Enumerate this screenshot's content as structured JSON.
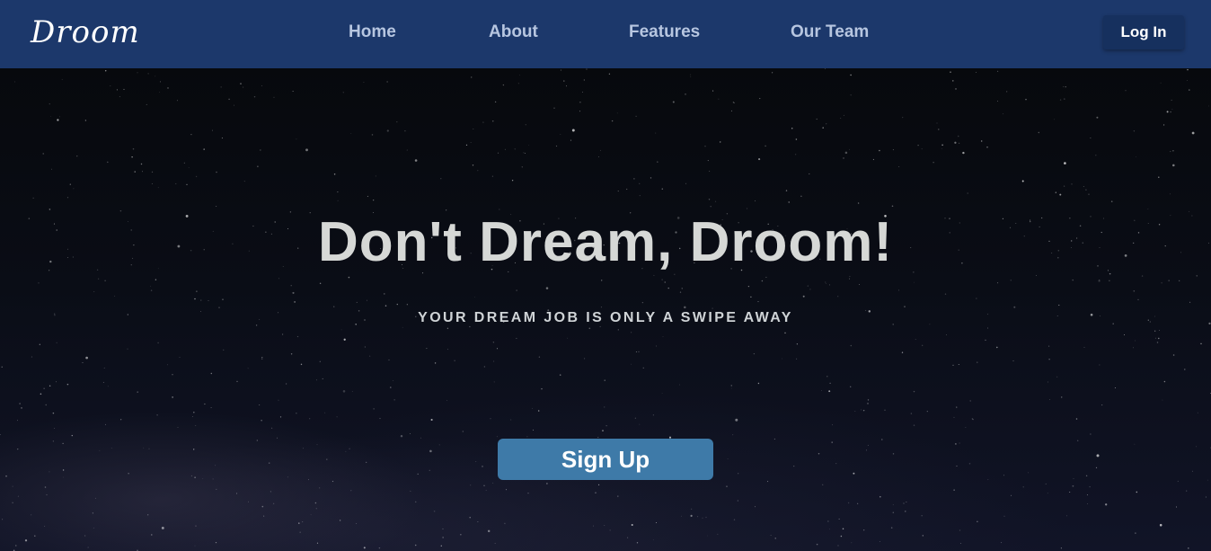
{
  "header": {
    "logo": "Droom",
    "nav": [
      {
        "label": "Home"
      },
      {
        "label": "About"
      },
      {
        "label": "Features"
      },
      {
        "label": "Our Team"
      }
    ],
    "login_label": "Log In"
  },
  "hero": {
    "title": "Don't Dream, Droom!",
    "subtitle": "YOUR DREAM JOB IS ONLY A SWIPE AWAY",
    "signup_label": "Sign Up"
  },
  "colors": {
    "navbar": "#1c386b",
    "nav_link": "#b7c6e0",
    "login_button": "#16305e",
    "signup_button": "#3e7aa8",
    "hero_text": "#d6d8d6"
  }
}
